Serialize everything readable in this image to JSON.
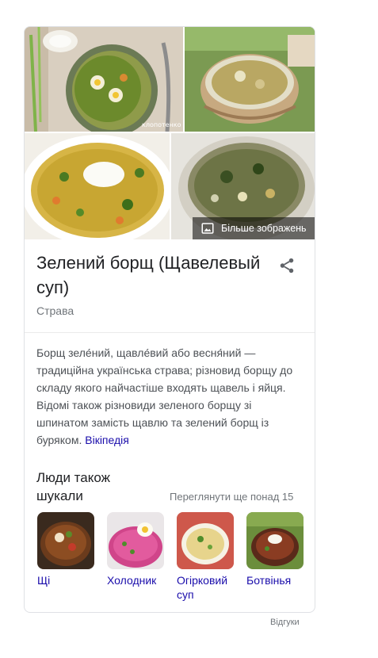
{
  "images": {
    "img1_alt": "soup-photo-1",
    "img1_watermark": "клопотенко",
    "img2_alt": "soup-photo-2",
    "img3_alt": "soup-photo-3",
    "img4_alt": "soup-photo-4",
    "more_images_label": "Більше зображень",
    "more_images_icon": "image-icon"
  },
  "entity": {
    "title": "Зелений борщ (Щавелевый суп)",
    "type": "Страва",
    "share_icon": "share-icon"
  },
  "description": {
    "text": "Борщ зеле́ний, щавле́вий або весня́ний — традиційна українська страва; різновид борщу до складу якого найчастіше входять щавель і яйця. Відомі також різновиди зеленого борщу зі шпинатом замість щавлю та зелений борщ із буряком. ",
    "source_link": "Вікіпедія"
  },
  "people_also_search": {
    "heading": "Люди також шукали",
    "more_label": "Переглянути ще понад 15",
    "items": [
      {
        "label": "Щі"
      },
      {
        "label": "Холодник"
      },
      {
        "label": "Огірковий суп"
      },
      {
        "label": "Ботвінья"
      }
    ]
  },
  "footer": {
    "feedback": "Відгуки"
  },
  "colors": {
    "link": "#1a0dab",
    "muted": "#70757a",
    "text": "#202124",
    "border": "#dfe1e5"
  }
}
